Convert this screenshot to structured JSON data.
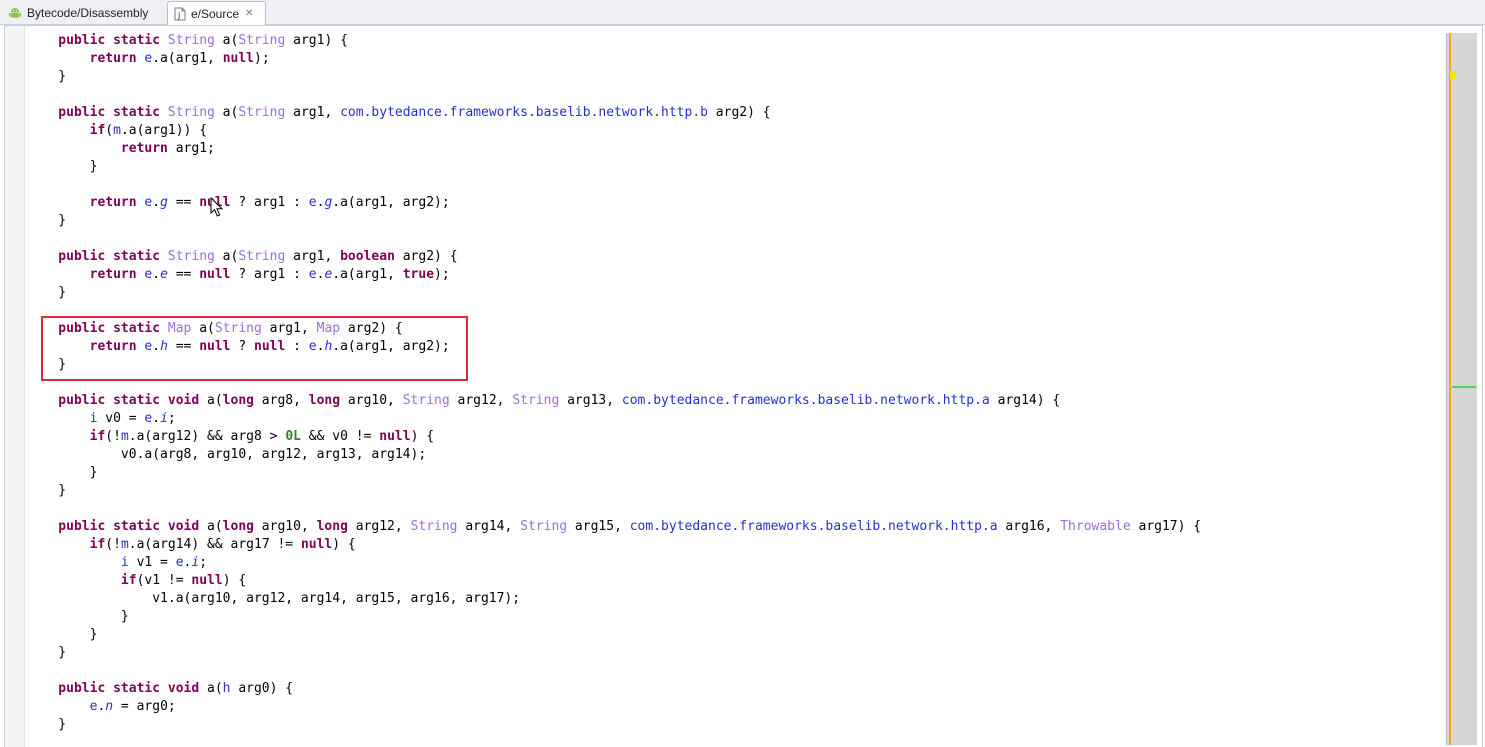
{
  "tabs": [
    {
      "label": "Bytecode/Disassembly",
      "icon": "android-icon",
      "active": false
    },
    {
      "label": "e/Source",
      "icon": "java-source-file-icon",
      "active": true
    }
  ],
  "colors": {
    "keyword": "#7f0055",
    "type": "#9b6ed8",
    "identifier": "#2530cf",
    "number": "#2a8a1a",
    "highlight_box": "#dd2b36"
  },
  "code_lines": [
    [
      [
        "kw",
        "    public static "
      ],
      [
        "ty",
        "String"
      ],
      [
        "t",
        " a("
      ],
      [
        "ty",
        "String"
      ],
      [
        "t",
        " arg1) {"
      ]
    ],
    [
      [
        "kw",
        "        return "
      ],
      [
        "id",
        "e"
      ],
      [
        "t",
        ".a(arg1, "
      ],
      [
        "kw",
        "null"
      ],
      [
        "t",
        ");"
      ]
    ],
    [
      [
        "t",
        "    }"
      ]
    ],
    [
      [
        "t",
        ""
      ]
    ],
    [
      [
        "kw",
        "    public static "
      ],
      [
        "ty",
        "String"
      ],
      [
        "t",
        " a("
      ],
      [
        "ty",
        "String"
      ],
      [
        "t",
        " arg1, "
      ],
      [
        "fq",
        "com.bytedance.frameworks.baselib.network.http.b"
      ],
      [
        "t",
        " arg2) {"
      ]
    ],
    [
      [
        "kw",
        "        if"
      ],
      [
        "t",
        "("
      ],
      [
        "id",
        "m"
      ],
      [
        "t",
        ".a(arg1)) {"
      ]
    ],
    [
      [
        "kw",
        "            return "
      ],
      [
        "t",
        "arg1;"
      ]
    ],
    [
      [
        "t",
        "        }"
      ]
    ],
    [
      [
        "t",
        ""
      ]
    ],
    [
      [
        "kw",
        "        return "
      ],
      [
        "id",
        "e"
      ],
      [
        "t",
        "."
      ],
      [
        "fi",
        "g"
      ],
      [
        "t",
        " == "
      ],
      [
        "kw",
        "null"
      ],
      [
        "t",
        " ? arg1 : "
      ],
      [
        "id",
        "e"
      ],
      [
        "t",
        "."
      ],
      [
        "fi",
        "g"
      ],
      [
        "t",
        ".a(arg1, arg2);"
      ]
    ],
    [
      [
        "t",
        "    }"
      ]
    ],
    [
      [
        "t",
        ""
      ]
    ],
    [
      [
        "kw",
        "    public static "
      ],
      [
        "ty",
        "String"
      ],
      [
        "t",
        " a("
      ],
      [
        "ty",
        "String"
      ],
      [
        "t",
        " arg1, "
      ],
      [
        "kw",
        "boolean"
      ],
      [
        "t",
        " arg2) {"
      ]
    ],
    [
      [
        "kw",
        "        return "
      ],
      [
        "id",
        "e"
      ],
      [
        "t",
        "."
      ],
      [
        "fi",
        "e"
      ],
      [
        "t",
        " == "
      ],
      [
        "kw",
        "null"
      ],
      [
        "t",
        " ? arg1 : "
      ],
      [
        "id",
        "e"
      ],
      [
        "t",
        "."
      ],
      [
        "fi",
        "e"
      ],
      [
        "t",
        ".a(arg1, "
      ],
      [
        "kw",
        "true"
      ],
      [
        "t",
        ");"
      ]
    ],
    [
      [
        "t",
        "    }"
      ]
    ],
    [
      [
        "t",
        ""
      ]
    ],
    [
      [
        "kw",
        "    public static "
      ],
      [
        "ty",
        "Map"
      ],
      [
        "t",
        " a("
      ],
      [
        "ty",
        "String"
      ],
      [
        "t",
        " arg1, "
      ],
      [
        "ty",
        "Map"
      ],
      [
        "t",
        " arg2) {"
      ]
    ],
    [
      [
        "kw",
        "        return "
      ],
      [
        "id",
        "e"
      ],
      [
        "t",
        "."
      ],
      [
        "fi",
        "h"
      ],
      [
        "t",
        " == "
      ],
      [
        "kw",
        "null"
      ],
      [
        "t",
        " ? "
      ],
      [
        "kw",
        "null"
      ],
      [
        "t",
        " : "
      ],
      [
        "id",
        "e"
      ],
      [
        "t",
        "."
      ],
      [
        "fi",
        "h"
      ],
      [
        "t",
        ".a(arg1, arg2);"
      ]
    ],
    [
      [
        "t",
        "    }"
      ]
    ],
    [
      [
        "t",
        ""
      ]
    ],
    [
      [
        "kw",
        "    public static void "
      ],
      [
        "t",
        "a("
      ],
      [
        "kw",
        "long"
      ],
      [
        "t",
        " arg8, "
      ],
      [
        "kw",
        "long"
      ],
      [
        "t",
        " arg10, "
      ],
      [
        "ty",
        "String"
      ],
      [
        "t",
        " arg12, "
      ],
      [
        "ty",
        "String"
      ],
      [
        "t",
        " arg13, "
      ],
      [
        "fq",
        "com.bytedance.frameworks.baselib.network.http.a"
      ],
      [
        "t",
        " arg14) {"
      ]
    ],
    [
      [
        "t",
        "        "
      ],
      [
        "id",
        "i"
      ],
      [
        "t",
        " v0 = "
      ],
      [
        "id",
        "e"
      ],
      [
        "t",
        "."
      ],
      [
        "fi",
        "i"
      ],
      [
        "t",
        ";"
      ]
    ],
    [
      [
        "kw",
        "        if"
      ],
      [
        "t",
        "(!"
      ],
      [
        "id",
        "m"
      ],
      [
        "t",
        ".a(arg12) && arg8 > "
      ],
      [
        "num",
        "0L"
      ],
      [
        "t",
        " && v0 != "
      ],
      [
        "kw",
        "null"
      ],
      [
        "t",
        ") {"
      ]
    ],
    [
      [
        "t",
        "            v0.a(arg8, arg10, arg12, arg13, arg14);"
      ]
    ],
    [
      [
        "t",
        "        }"
      ]
    ],
    [
      [
        "t",
        "    }"
      ]
    ],
    [
      [
        "t",
        ""
      ]
    ],
    [
      [
        "kw",
        "    public static void "
      ],
      [
        "t",
        "a("
      ],
      [
        "kw",
        "long"
      ],
      [
        "t",
        " arg10, "
      ],
      [
        "kw",
        "long"
      ],
      [
        "t",
        " arg12, "
      ],
      [
        "ty",
        "String"
      ],
      [
        "t",
        " arg14, "
      ],
      [
        "ty",
        "String"
      ],
      [
        "t",
        " arg15, "
      ],
      [
        "fq",
        "com.bytedance.frameworks.baselib.network.http.a"
      ],
      [
        "t",
        " arg16, "
      ],
      [
        "ty",
        "Throwable"
      ],
      [
        "t",
        " arg17) {"
      ]
    ],
    [
      [
        "kw",
        "        if"
      ],
      [
        "t",
        "(!"
      ],
      [
        "id",
        "m"
      ],
      [
        "t",
        ".a(arg14) && arg17 != "
      ],
      [
        "kw",
        "null"
      ],
      [
        "t",
        ") {"
      ]
    ],
    [
      [
        "t",
        "            "
      ],
      [
        "id",
        "i"
      ],
      [
        "t",
        " v1 = "
      ],
      [
        "id",
        "e"
      ],
      [
        "t",
        "."
      ],
      [
        "fi",
        "i"
      ],
      [
        "t",
        ";"
      ]
    ],
    [
      [
        "kw",
        "            if"
      ],
      [
        "t",
        "(v1 != "
      ],
      [
        "kw",
        "null"
      ],
      [
        "t",
        ") {"
      ]
    ],
    [
      [
        "t",
        "                v1.a(arg10, arg12, arg14, arg15, arg16, arg17);"
      ]
    ],
    [
      [
        "t",
        "            }"
      ]
    ],
    [
      [
        "t",
        "        }"
      ]
    ],
    [
      [
        "t",
        "    }"
      ]
    ],
    [
      [
        "t",
        ""
      ]
    ],
    [
      [
        "kw",
        "    public static void "
      ],
      [
        "t",
        "a("
      ],
      [
        "id",
        "h"
      ],
      [
        "t",
        " arg0) {"
      ]
    ],
    [
      [
        "t",
        "        "
      ],
      [
        "id",
        "e"
      ],
      [
        "t",
        "."
      ],
      [
        "fi",
        "n"
      ],
      [
        "t",
        " = arg0;"
      ]
    ],
    [
      [
        "t",
        "    }"
      ]
    ]
  ]
}
